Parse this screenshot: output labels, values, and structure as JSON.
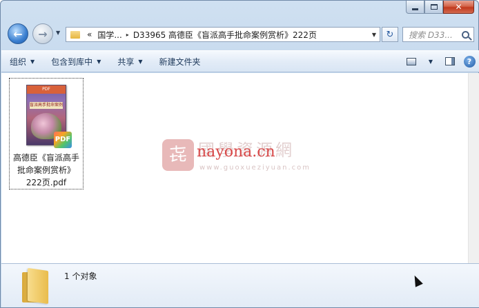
{
  "window": {
    "caption": {
      "minimize_icon": "minimize-icon",
      "maximize_icon": "maximize-icon",
      "close_glyph": "✕"
    }
  },
  "nav": {
    "back_glyph": "←",
    "forward_glyph": "→",
    "recent_glyph": "▼",
    "address": {
      "overflow": "«",
      "crumbs": [
        "国学...",
        "D33965 高德臣《盲派高手批命案例赏析》222页"
      ],
      "separator": "▸",
      "dropdown": "▼"
    },
    "refresh_glyph": "↻",
    "search_placeholder": "搜索 D33..."
  },
  "toolbar": {
    "organize": "组织",
    "include_in_library": "包含到库中",
    "share": "共享",
    "new_folder": "新建文件夹",
    "dropdown_arrow": "▼",
    "help_glyph": "?"
  },
  "file": {
    "name_line1": "高德臣《盲派高手",
    "name_line2": "批命案例赏析》",
    "name_line3": "222页.pdf",
    "badge": "PDF",
    "cover_top": "PDF",
    "cover_title": "盲派高手批命案例"
  },
  "watermark": {
    "seal": "㐂",
    "cn": "國學資源網",
    "en": "nayona.cn",
    "url": "www.guoxueziyuan.com"
  },
  "details": {
    "count": "1 个对象"
  }
}
